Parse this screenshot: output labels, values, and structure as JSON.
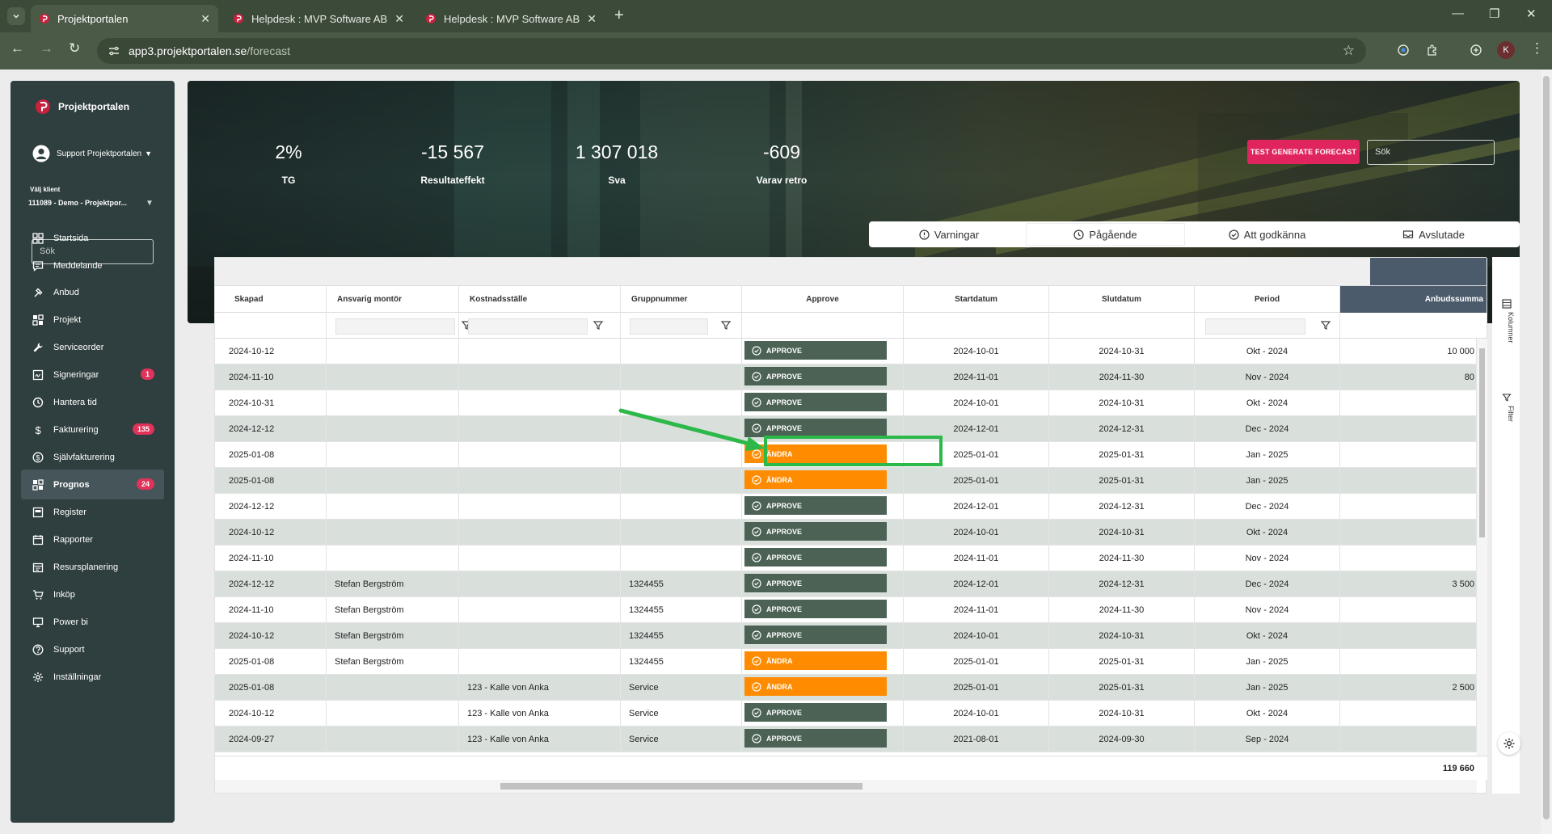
{
  "browser": {
    "tabs": [
      {
        "title": "Projektportalen",
        "active": true
      },
      {
        "title": "Helpdesk : MVP Software AB",
        "active": false
      },
      {
        "title": "Helpdesk : MVP Software AB",
        "active": false
      }
    ],
    "url_domain": "app3.projektportalen.se",
    "url_path": "/forecast",
    "profile_initial": "K"
  },
  "sidebar": {
    "app_name": "Projektportalen",
    "user": "Support Projektportalen",
    "client_label": "Välj klient",
    "client_value": "111089 - Demo - Projektpor...",
    "search_placeholder": "Sök",
    "items": [
      {
        "label": "Startsida",
        "icon": "dashboard-icon"
      },
      {
        "label": "Meddelande",
        "icon": "message-icon"
      },
      {
        "label": "Anbud",
        "icon": "hammer-icon"
      },
      {
        "label": "Projekt",
        "icon": "grid-icon"
      },
      {
        "label": "Serviceorder",
        "icon": "wrench-icon"
      },
      {
        "label": "Signeringar",
        "icon": "signature-icon",
        "badge": "1"
      },
      {
        "label": "Hantera tid",
        "icon": "clock-icon"
      },
      {
        "label": "Fakturering",
        "icon": "dollar-icon",
        "badge": "135"
      },
      {
        "label": "Självfakturering",
        "icon": "dollar-circle-icon"
      },
      {
        "label": "Prognos",
        "icon": "grid-icon",
        "badge": "24",
        "active": true
      },
      {
        "label": "Register",
        "icon": "register-icon"
      },
      {
        "label": "Rapporter",
        "icon": "calendar-icon"
      },
      {
        "label": "Resursplanering",
        "icon": "calendar-list-icon"
      },
      {
        "label": "Inköp",
        "icon": "cart-icon"
      },
      {
        "label": "Power bi",
        "icon": "monitor-icon"
      },
      {
        "label": "Support",
        "icon": "help-icon"
      },
      {
        "label": "Inställningar",
        "icon": "gear-icon"
      }
    ]
  },
  "stats": [
    {
      "value": "2%",
      "label": "TG"
    },
    {
      "value": "-15 567",
      "label": "Resultateffekt"
    },
    {
      "value": "1 307 018",
      "label": "Sva"
    },
    {
      "value": "-609",
      "label": "Varav retro"
    }
  ],
  "actions": {
    "generate_label": "TEST GENERATE FORECAST",
    "search_placeholder": "Sök"
  },
  "status_tabs": [
    {
      "label": "Varningar"
    },
    {
      "label": "Pågående",
      "selected": true
    },
    {
      "label": "Att godkänna"
    },
    {
      "label": "Avslutade"
    }
  ],
  "grid": {
    "columns": [
      "Skapad",
      "Ansvarig montör",
      "Kostnadsställe",
      "Gruppnummer",
      "Approve",
      "Startdatum",
      "Slutdatum",
      "Period",
      "Anbudssumma"
    ],
    "rows": [
      {
        "skapad": "2024-10-12",
        "montor": "",
        "kst": "",
        "grupp": "",
        "approve": "APPROVE",
        "start": "2024-10-01",
        "slut": "2024-10-31",
        "period": "Okt - 2024",
        "anbud": "10 000"
      },
      {
        "skapad": "2024-11-10",
        "montor": "",
        "kst": "",
        "grupp": "",
        "approve": "APPROVE",
        "start": "2024-11-01",
        "slut": "2024-11-30",
        "period": "Nov - 2024",
        "anbud": "80"
      },
      {
        "skapad": "2024-10-31",
        "montor": "",
        "kst": "",
        "grupp": "",
        "approve": "APPROVE",
        "start": "2024-10-01",
        "slut": "2024-10-31",
        "period": "Okt - 2024",
        "anbud": ""
      },
      {
        "skapad": "2024-12-12",
        "montor": "",
        "kst": "",
        "grupp": "",
        "approve": "APPROVE",
        "start": "2024-12-01",
        "slut": "2024-12-31",
        "period": "Dec - 2024",
        "anbud": ""
      },
      {
        "skapad": "2025-01-08",
        "montor": "",
        "kst": "",
        "grupp": "",
        "approve": "ÄNDRA",
        "start": "2025-01-01",
        "slut": "2025-01-31",
        "period": "Jan - 2025",
        "anbud": ""
      },
      {
        "skapad": "2025-01-08",
        "montor": "",
        "kst": "",
        "grupp": "",
        "approve": "ÄNDRA",
        "start": "2025-01-01",
        "slut": "2025-01-31",
        "period": "Jan - 2025",
        "anbud": ""
      },
      {
        "skapad": "2024-12-12",
        "montor": "",
        "kst": "",
        "grupp": "",
        "approve": "APPROVE",
        "start": "2024-12-01",
        "slut": "2024-12-31",
        "period": "Dec - 2024",
        "anbud": ""
      },
      {
        "skapad": "2024-10-12",
        "montor": "",
        "kst": "",
        "grupp": "",
        "approve": "APPROVE",
        "start": "2024-10-01",
        "slut": "2024-10-31",
        "period": "Okt - 2024",
        "anbud": ""
      },
      {
        "skapad": "2024-11-10",
        "montor": "",
        "kst": "",
        "grupp": "",
        "approve": "APPROVE",
        "start": "2024-11-01",
        "slut": "2024-11-30",
        "period": "Nov - 2024",
        "anbud": ""
      },
      {
        "skapad": "2024-12-12",
        "montor": "Stefan Bergström",
        "kst": "",
        "grupp": "1324455",
        "approve": "APPROVE",
        "start": "2024-12-01",
        "slut": "2024-12-31",
        "period": "Dec - 2024",
        "anbud": "3 500"
      },
      {
        "skapad": "2024-11-10",
        "montor": "Stefan Bergström",
        "kst": "",
        "grupp": "1324455",
        "approve": "APPROVE",
        "start": "2024-11-01",
        "slut": "2024-11-30",
        "period": "Nov - 2024",
        "anbud": ""
      },
      {
        "skapad": "2024-10-12",
        "montor": "Stefan Bergström",
        "kst": "",
        "grupp": "1324455",
        "approve": "APPROVE",
        "start": "2024-10-01",
        "slut": "2024-10-31",
        "period": "Okt - 2024",
        "anbud": ""
      },
      {
        "skapad": "2025-01-08",
        "montor": "Stefan Bergström",
        "kst": "",
        "grupp": "1324455",
        "approve": "ÄNDRA",
        "start": "2025-01-01",
        "slut": "2025-01-31",
        "period": "Jan - 2025",
        "anbud": ""
      },
      {
        "skapad": "2025-01-08",
        "montor": "",
        "kst": "123 - Kalle von Anka",
        "grupp": "Service",
        "approve": "ÄNDRA",
        "start": "2025-01-01",
        "slut": "2025-01-31",
        "period": "Jan - 2025",
        "anbud": "2 500"
      },
      {
        "skapad": "2024-10-12",
        "montor": "",
        "kst": "123 - Kalle von Anka",
        "grupp": "Service",
        "approve": "APPROVE",
        "start": "2024-10-01",
        "slut": "2024-10-31",
        "period": "Okt - 2024",
        "anbud": ""
      },
      {
        "skapad": "2024-09-27",
        "montor": "",
        "kst": "123 - Kalle von Anka",
        "grupp": "Service",
        "approve": "APPROVE",
        "start": "2021-08-01",
        "slut": "2024-09-30",
        "period": "Sep - 2024",
        "anbud": ""
      }
    ],
    "total_anbud": "119 660"
  },
  "side_panel": {
    "columns_label": "Kolumner",
    "filter_label": "Filter"
  },
  "colors": {
    "approve": "#4b6255",
    "andra": "#ff8c00",
    "accent": "#e0245e",
    "highlight": "#2db84a",
    "sidebar": "#2f3e3e"
  }
}
